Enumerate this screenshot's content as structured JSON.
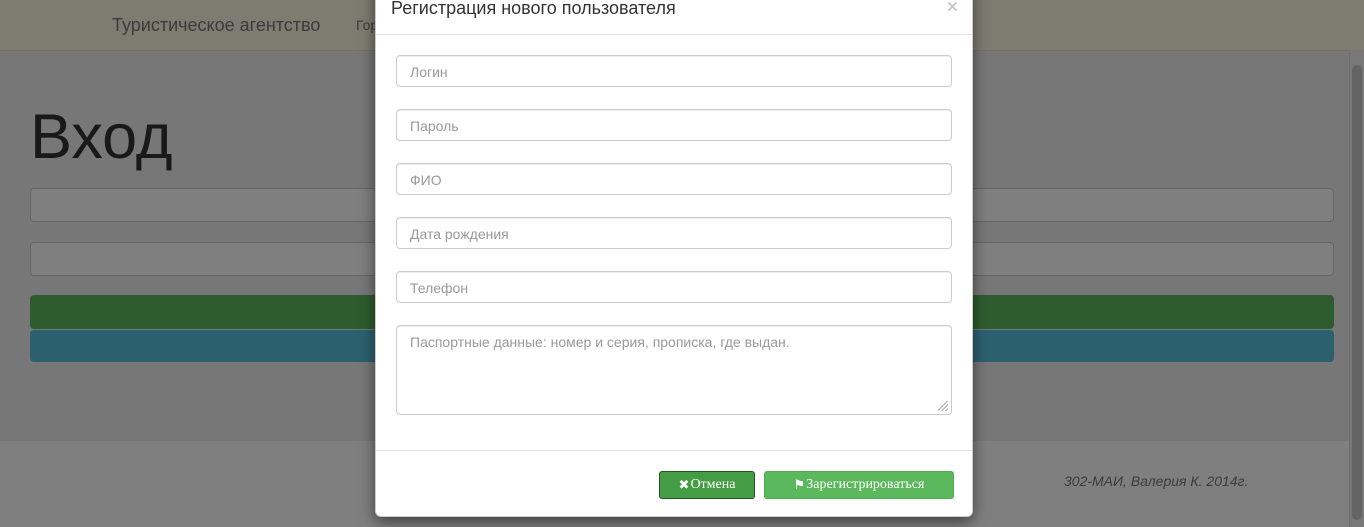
{
  "navbar": {
    "brand": "Туристическое агентство",
    "link": "Гор"
  },
  "login": {
    "title": "Вход"
  },
  "footer": {
    "text": "302-МАИ, Валерия К. 2014г."
  },
  "modal": {
    "title": "Регистрация нового пользователя",
    "close_label": "×",
    "fields": [
      {
        "placeholder": "Логин"
      },
      {
        "placeholder": "Пароль"
      },
      {
        "placeholder": "ФИО"
      },
      {
        "placeholder": "Дата рождения"
      },
      {
        "placeholder": "Телефон"
      }
    ],
    "textarea_placeholder": "Паспортные данные: номер и серия, прописка, где выдан.",
    "buttons": {
      "cancel_icon": "✖",
      "cancel_label": "Отмена",
      "register_icon": "⚑",
      "register_label": "Зарегистрироваться"
    }
  },
  "colors": {
    "navbar_bg": "#fcf8e3",
    "success": "#5cb85c",
    "info": "#5bc0de"
  }
}
